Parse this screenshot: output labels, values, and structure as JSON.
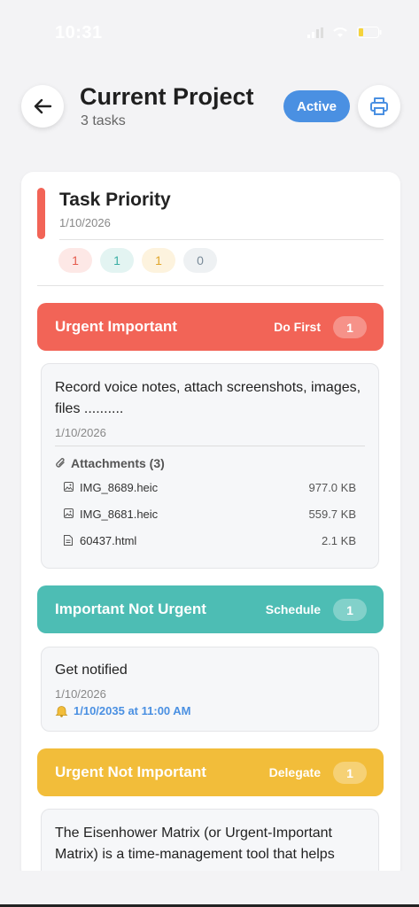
{
  "status_bar": {
    "time": "10:31"
  },
  "header": {
    "title": "Current Project",
    "subtitle": "3 tasks",
    "status_badge": "Active"
  },
  "card": {
    "title": "Task Priority",
    "date": "1/10/2026",
    "counts": [
      "1",
      "1",
      "1",
      "0"
    ]
  },
  "sections": [
    {
      "name": "Urgent Important",
      "action": "Do First",
      "count": "1",
      "color": "#f26457"
    },
    {
      "name": "Important Not Urgent",
      "action": "Schedule",
      "count": "1",
      "color": "#4dbdb4"
    },
    {
      "name": "Urgent Not Important",
      "action": "Delegate",
      "count": "1",
      "color": "#f2bd3a"
    }
  ],
  "tasks": [
    {
      "text": "Record voice notes, attach screenshots, images, files ..........",
      "date": "1/10/2026",
      "attachments_label": "Attachments (3)",
      "attachments": [
        {
          "name": "IMG_8689.heic",
          "size": "977.0 KB",
          "icon": "image-file-icon"
        },
        {
          "name": "IMG_8681.heic",
          "size": "559.7 KB",
          "icon": "image-file-icon"
        },
        {
          "name": "60437.html",
          "size": "2.1 KB",
          "icon": "document-file-icon"
        }
      ]
    },
    {
      "text": "Get notified",
      "date": "1/10/2026",
      "reminder": "1/10/2035 at 11:00 AM"
    },
    {
      "text": "The Eisenhower Matrix (or Urgent-Important Matrix) is a time-management tool that helps"
    }
  ]
}
